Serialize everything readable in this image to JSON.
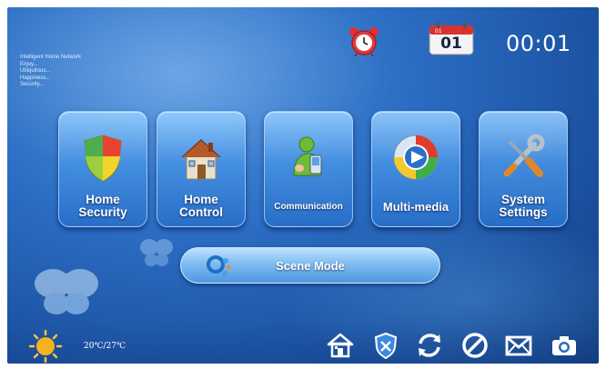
{
  "header": {
    "tagline": [
      "Intelligent Home Network",
      "Enjoy...",
      "Ubiquitous...",
      "Happiness...",
      "Security..."
    ],
    "calendar_day": "01",
    "time": "00:01",
    "alarm_icon": "alarm-clock-icon",
    "calendar_icon": "calendar-icon"
  },
  "tiles": [
    {
      "label": "Home\nSecurity",
      "icon": "shield-icon"
    },
    {
      "label": "Home\nControl",
      "icon": "house-icon"
    },
    {
      "label": "Communication",
      "icon": "messenger-person-icon"
    },
    {
      "label": "Multi-media",
      "icon": "media-player-icon"
    },
    {
      "label": "System\nSettings",
      "icon": "tools-icon"
    }
  ],
  "scene": {
    "label": "Scene Mode",
    "icon": "scene-bubbles-icon"
  },
  "weather": {
    "temperature": "20℃/27℃",
    "icon": "sun-icon"
  },
  "statusbar": {
    "icons": [
      "home-icon",
      "shield-status-icon",
      "sync-icon",
      "prohibited-icon",
      "mail-icon",
      "camera-icon"
    ]
  },
  "colors": {
    "background": "#2a6cc2",
    "tile": "#4e97df",
    "text": "#ffffff"
  }
}
